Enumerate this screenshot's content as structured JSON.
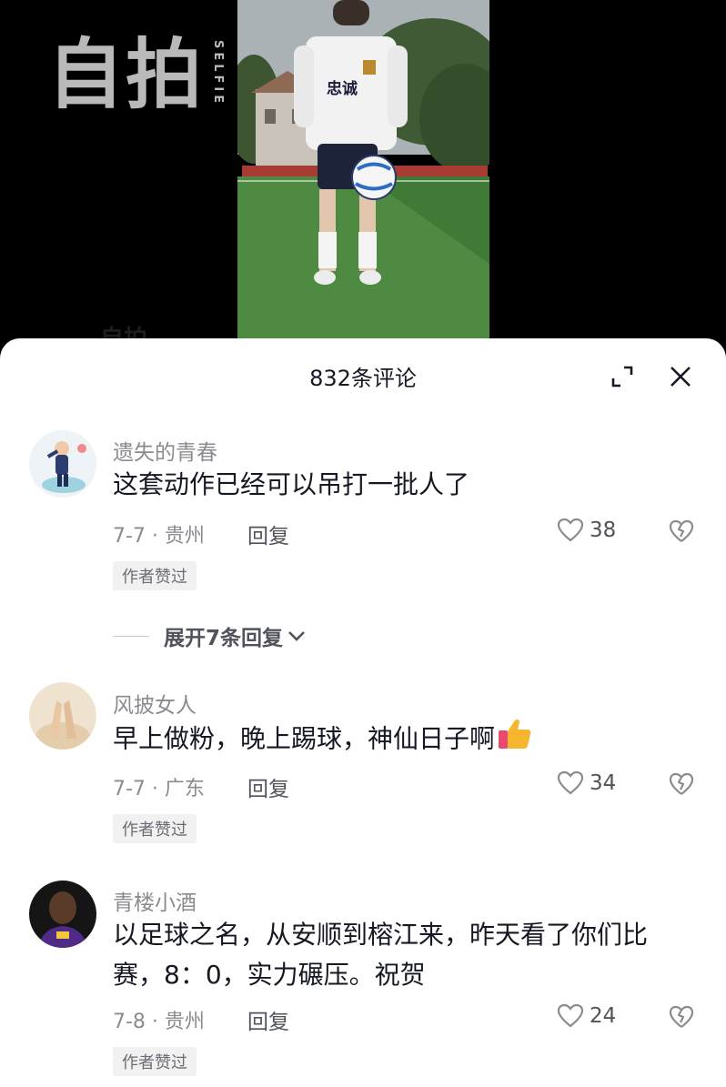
{
  "video": {
    "watermark_main": "自拍",
    "watermark_side": "SELFIE",
    "jersey_text": "忠诚"
  },
  "comments_panel": {
    "title": "832条评论",
    "expand_icon": "expand-icon",
    "close_icon": "close-icon"
  },
  "comments": [
    {
      "username": "遗失的青春",
      "text": "这套动作已经可以吊打一批人了",
      "meta": "7-7 · 贵州",
      "reply_label": "回复",
      "likes": "38",
      "badge": "作者赞过",
      "expand_replies": "展开7条回复"
    },
    {
      "username": "风披女人",
      "text": "早上做粉，晚上踢球，神仙日子啊",
      "meta": "7-7 · 广东",
      "reply_label": "回复",
      "likes": "34",
      "badge": "作者赞过"
    },
    {
      "username": "青楼小酒",
      "text": "以足球之名，从安顺到榕江来，昨天看了你们比赛，8：0，实力碾压。祝贺",
      "meta": "7-8 · 贵州",
      "reply_label": "回复",
      "likes": "24",
      "badge": "作者赞过"
    }
  ],
  "colors": {
    "text_primary": "#161823",
    "text_secondary": "#8a8b91",
    "badge_bg": "#f1f1f2",
    "sheet_bg": "#ffffff"
  }
}
